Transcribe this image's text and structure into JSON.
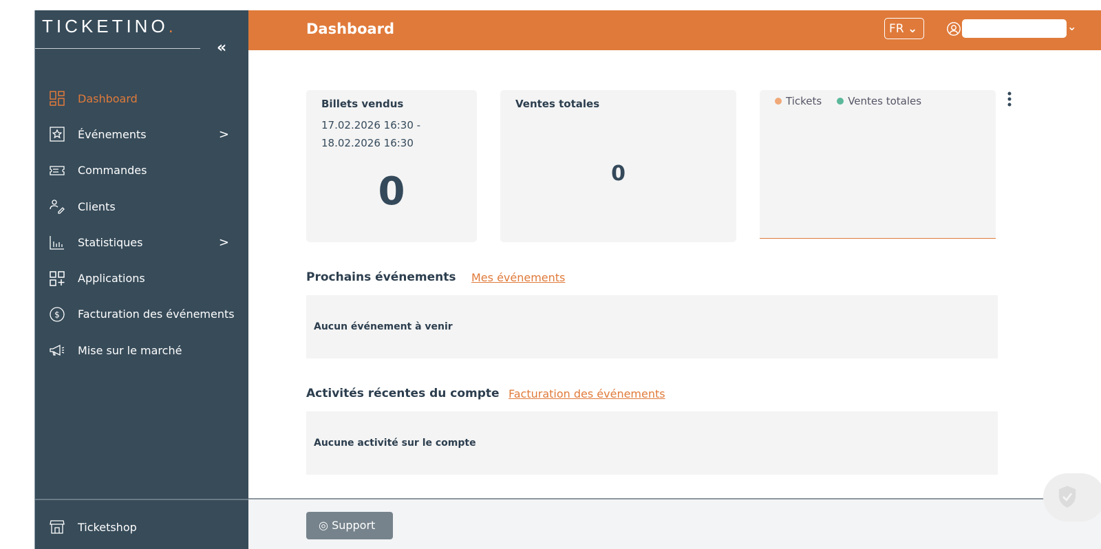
{
  "brand": {
    "logo": "TICKETINO",
    "accent": "#e07a3a",
    "sidebar_bg": "#374b59"
  },
  "sidebar": {
    "collapse_icon": "double-chevron-left",
    "items": [
      {
        "label": "Dashboard",
        "icon": "dashboard-icon",
        "active": true
      },
      {
        "label": "Événements",
        "icon": "star-icon",
        "has_submenu": true
      },
      {
        "label": "Commandes",
        "icon": "ticket-icon"
      },
      {
        "label": "Clients",
        "icon": "users-icon"
      },
      {
        "label": "Statistiques",
        "icon": "bar-chart-icon",
        "has_submenu": true
      },
      {
        "label": "Applications",
        "icon": "apps-icon"
      },
      {
        "label": "Facturation des événements",
        "icon": "dollar-icon"
      },
      {
        "label": "Mise sur le marché",
        "icon": "megaphone-icon"
      }
    ],
    "footer": {
      "label": "Ticketshop",
      "icon": "shop-icon"
    }
  },
  "header": {
    "title": "Dashboard",
    "language": "FR"
  },
  "cards": {
    "tickets": {
      "title": "Billets vendus",
      "date_from": "17.02.2026 16:30 -",
      "date_to": "18.02.2026 16:30",
      "value": "0"
    },
    "sales": {
      "title": "Ventes totales",
      "value": "0"
    },
    "chart": {
      "legend": [
        {
          "label": "Tickets",
          "color": "#f0a878"
        },
        {
          "label": "Ventes totales",
          "color": "#5bb89a"
        }
      ]
    }
  },
  "upcoming": {
    "title": "Prochains événements",
    "link": "Mes événements",
    "empty": "Aucun événement à venir"
  },
  "activity": {
    "title": "Activités récentes du compte",
    "link": "Facturation des événements",
    "empty": "Aucune activité sur le compte"
  },
  "footer": {
    "support": "Support"
  }
}
